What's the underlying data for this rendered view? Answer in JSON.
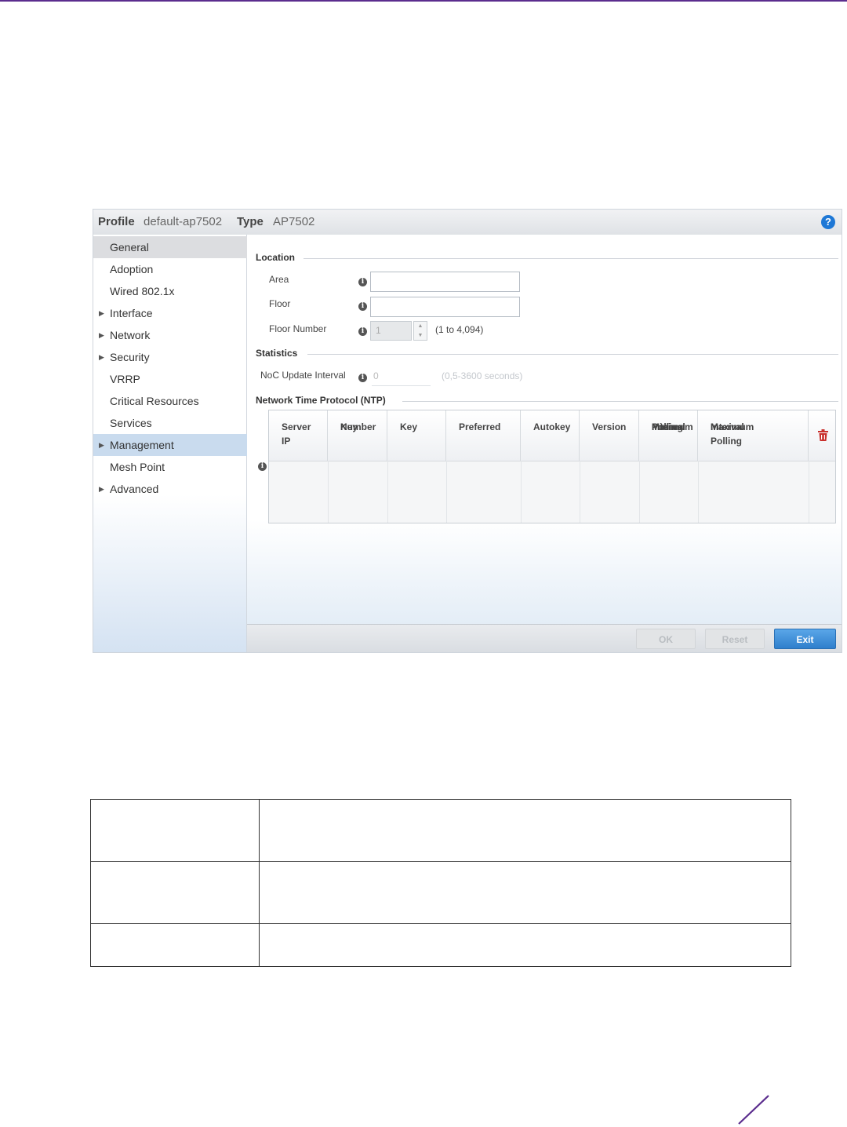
{
  "header": {
    "profile_label": "Profile",
    "profile_value": "default-ap7502",
    "type_label": "Type",
    "type_value": "AP7502",
    "help_glyph": "?"
  },
  "sidebar": {
    "items": [
      {
        "label": "General",
        "expandable": false,
        "state": "selected"
      },
      {
        "label": "Adoption",
        "expandable": false
      },
      {
        "label": "Wired 802.1x",
        "expandable": false
      },
      {
        "label": "Interface",
        "expandable": true
      },
      {
        "label": "Network",
        "expandable": true
      },
      {
        "label": "Security",
        "expandable": true
      },
      {
        "label": "VRRP",
        "expandable": false
      },
      {
        "label": "Critical Resources",
        "expandable": false
      },
      {
        "label": "Services",
        "expandable": false
      },
      {
        "label": "Management",
        "expandable": true,
        "state": "highlighted"
      },
      {
        "label": "Mesh Point",
        "expandable": false
      },
      {
        "label": "Advanced",
        "expandable": true
      }
    ]
  },
  "location": {
    "title": "Location",
    "area_label": "Area",
    "area_value": "",
    "floor_label": "Floor",
    "floor_value": "",
    "floor_number_label": "Floor Number",
    "floor_number_value": "1",
    "floor_number_range": "(1 to 4,094)"
  },
  "statistics": {
    "title": "Statistics",
    "noc_label": "NoC Update Interval",
    "noc_value": "0",
    "noc_range": "(0,5-3600 seconds)"
  },
  "ntp": {
    "title": "Network Time Protocol (NTP)",
    "columns": [
      [
        "Server IP"
      ],
      [
        "Key",
        "Number"
      ],
      [
        "Key"
      ],
      [
        "Preferred"
      ],
      [
        "Autokey"
      ],
      [
        "Version"
      ],
      [
        "Minimum",
        "Polling",
        "Interval"
      ],
      [
        "Maximum Polling",
        "Interval"
      ]
    ],
    "rows": []
  },
  "footer": {
    "ok_label": "OK",
    "reset_label": "Reset",
    "exit_label": "Exit"
  },
  "colors": {
    "accent_blue": "#2f7fcc",
    "selected_nav": "#c9dbee",
    "delete_red": "#c9302c",
    "brand_purple": "#5b2d8e"
  }
}
